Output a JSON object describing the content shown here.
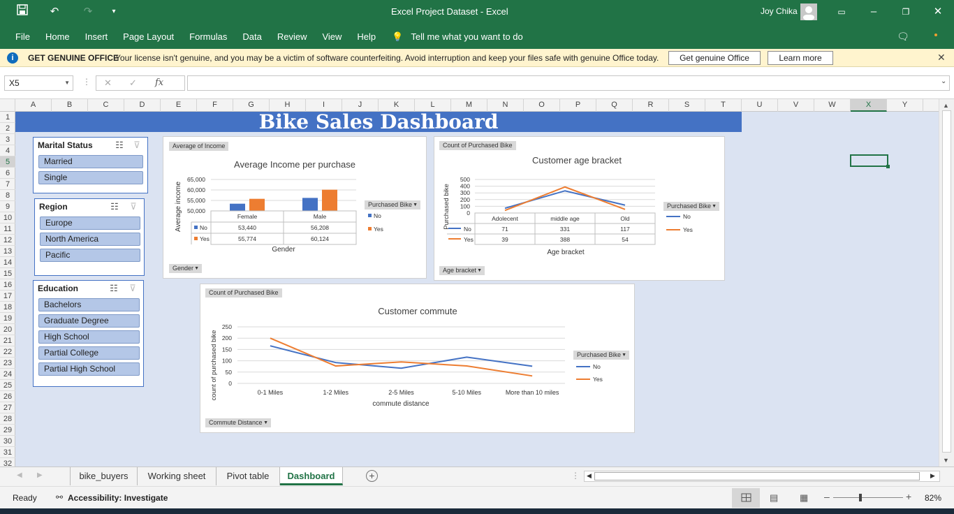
{
  "window": {
    "title": "Excel Project Dataset  -  Excel",
    "user": "Joy Chika"
  },
  "ribbon": {
    "tabs": [
      "File",
      "Home",
      "Insert",
      "Page Layout",
      "Formulas",
      "Data",
      "Review",
      "View",
      "Help"
    ],
    "tell_me": "Tell me what you want to do"
  },
  "infobar": {
    "heading": "GET GENUINE OFFICE",
    "message": "Your license isn't genuine, and you may be a victim of software counterfeiting. Avoid interruption and keep your files safe with genuine Office today.",
    "btn_genuine": "Get genuine Office",
    "btn_learn": "Learn more"
  },
  "formula": {
    "name_box": "X5",
    "fx": "fx",
    "value": ""
  },
  "columns": [
    "A",
    "B",
    "C",
    "D",
    "E",
    "F",
    "G",
    "H",
    "I",
    "J",
    "K",
    "L",
    "M",
    "N",
    "O",
    "P",
    "Q",
    "R",
    "S",
    "T",
    "U",
    "V",
    "W",
    "X",
    "Y"
  ],
  "rows": [
    "1",
    "2",
    "3",
    "4",
    "5",
    "6",
    "7",
    "8",
    "9",
    "10",
    "11",
    "12",
    "13",
    "14",
    "15",
    "16",
    "17",
    "18",
    "19",
    "20",
    "21",
    "22",
    "23",
    "24",
    "25",
    "26",
    "27",
    "28",
    "29",
    "30",
    "31",
    "32"
  ],
  "dashboard": {
    "title": "Bike Sales Dashboard"
  },
  "slicers": {
    "marital": {
      "title": "Marital Status",
      "items": [
        "Married",
        "Single"
      ]
    },
    "region": {
      "title": "Region",
      "items": [
        "Europe",
        "North America",
        "Pacific"
      ]
    },
    "education": {
      "title": "Education",
      "items": [
        "Bachelors",
        "Graduate Degree",
        "High School",
        "Partial College",
        "Partial High School"
      ]
    }
  },
  "charts": {
    "income": {
      "field_btn": "Average of Income",
      "axis_btn": "Gender",
      "legend_btn": "Purchased Bike",
      "title": "Average Income per purchase",
      "ylabel": "Average income",
      "xlabel": "Gender"
    },
    "age": {
      "field_btn": "Count of Purchased Bike",
      "axis_btn": "Age bracket",
      "legend_btn": "Purchased Bike",
      "title": "Customer age bracket",
      "ylabel": "Purchased bike",
      "xlabel": "Age bracket"
    },
    "commute": {
      "field_btn": "Count of Purchased Bike",
      "axis_btn": "Commute Distance",
      "legend_btn": "Purchased Bike",
      "title": "Customer commute",
      "ylabel": "count of purchased bike",
      "xlabel": "commute distance"
    }
  },
  "chart_data": [
    {
      "type": "bar",
      "title": "Average Income per purchase",
      "xlabel": "Gender",
      "ylabel": "Average income",
      "categories": [
        "Female",
        "Male"
      ],
      "series": [
        {
          "name": "No",
          "values": [
            53440,
            56208
          ],
          "labels": [
            "53,440",
            "56,208"
          ],
          "color": "#4472c4"
        },
        {
          "name": "Yes",
          "values": [
            55774,
            60124
          ],
          "labels": [
            "55,774",
            "60,124"
          ],
          "color": "#ed7d31"
        }
      ],
      "yticks": [
        "65,000",
        "60,000",
        "55,000",
        "50,000"
      ],
      "ylim": [
        50000,
        65000
      ],
      "legend": "right"
    },
    {
      "type": "line",
      "title": "Customer age bracket",
      "xlabel": "Age bracket",
      "ylabel": "Purchased bike",
      "categories": [
        "Adolecent",
        "middle age",
        "Old"
      ],
      "series": [
        {
          "name": "No",
          "values": [
            71,
            331,
            117
          ],
          "labels": [
            "71",
            "331",
            "117"
          ],
          "color": "#4472c4"
        },
        {
          "name": "Yes",
          "values": [
            39,
            388,
            54
          ],
          "labels": [
            "39",
            "388",
            "54"
          ],
          "color": "#ed7d31"
        }
      ],
      "yticks": [
        "500",
        "400",
        "300",
        "200",
        "100",
        "0"
      ],
      "ylim": [
        0,
        500
      ],
      "legend": "right"
    },
    {
      "type": "line",
      "title": "Customer commute",
      "xlabel": "commute distance",
      "ylabel": "count of purchased bike",
      "categories": [
        "0-1 Miles",
        "1-2 Miles",
        "2-5 Miles",
        "5-10 Miles",
        "More than 10 miles"
      ],
      "series": [
        {
          "name": "No",
          "values": [
            166,
            92,
            67,
            116,
            76
          ],
          "color": "#4472c4"
        },
        {
          "name": "Yes",
          "values": [
            200,
            77,
            95,
            77,
            33
          ],
          "color": "#ed7d31"
        }
      ],
      "yticks": [
        "250",
        "200",
        "150",
        "100",
        "50",
        "0"
      ],
      "ylim": [
        0,
        250
      ],
      "legend": "right"
    }
  ],
  "sheets": {
    "tabs": [
      "bike_buyers",
      "Working sheet",
      "Pivot table",
      "Dashboard"
    ],
    "active": "Dashboard"
  },
  "status": {
    "ready": "Ready",
    "accessibility": "Accessibility: Investigate",
    "zoom": "82%"
  }
}
